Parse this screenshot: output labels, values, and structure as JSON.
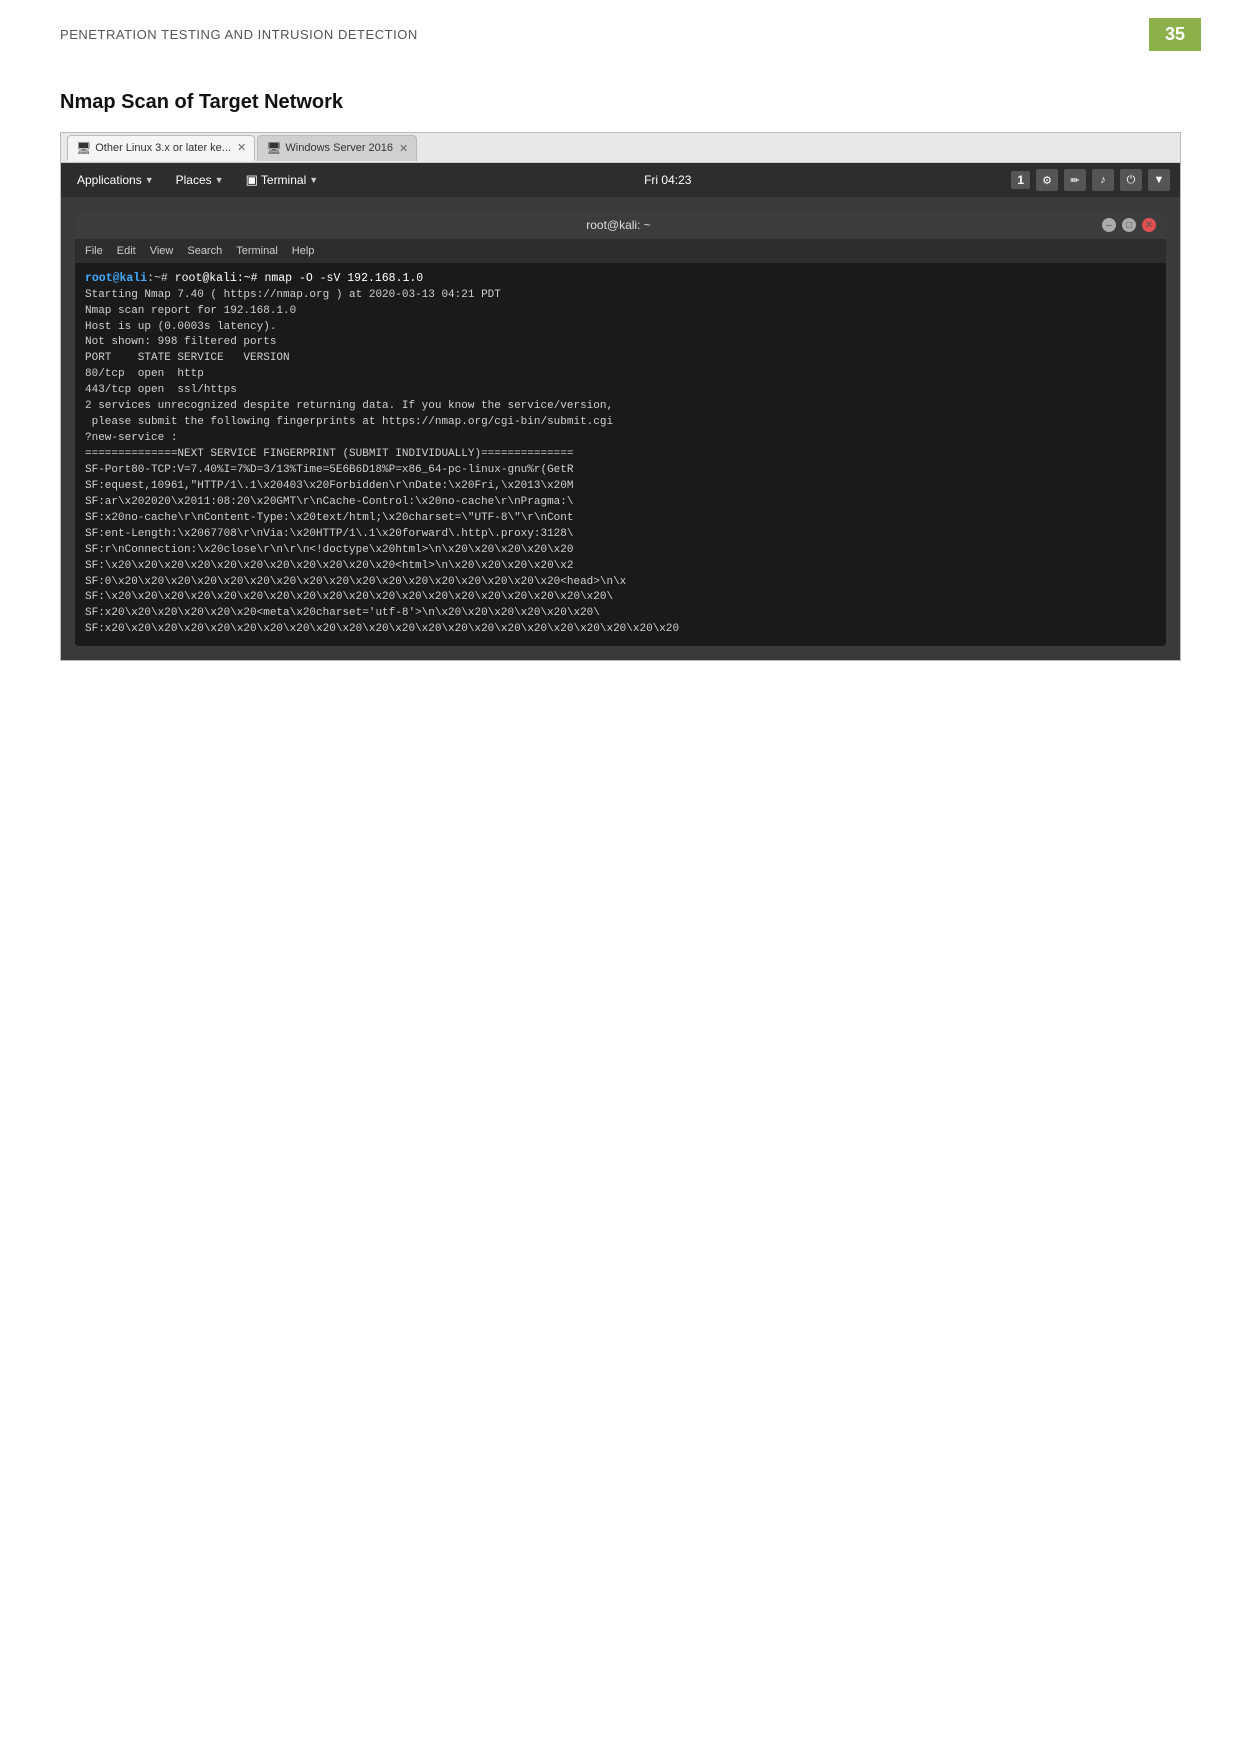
{
  "header": {
    "title": "PENETRATION TESTING AND INTRUSION DETECTION",
    "page_number": "35"
  },
  "section": {
    "heading": "Nmap Scan of Target Network"
  },
  "tabs": [
    {
      "label": "Other Linux 3.x or later ke...",
      "icon": "🖥",
      "active": true
    },
    {
      "label": "Windows Server 2016",
      "icon": "🖥",
      "active": false
    }
  ],
  "kali_toolbar": {
    "applications": "Applications",
    "places": "Places",
    "terminal": "Terminal",
    "clock": "Fri 04:23",
    "indicator": "1"
  },
  "terminal": {
    "title": "root@kali: ~",
    "menu_items": [
      "File",
      "Edit",
      "View",
      "Search",
      "Terminal",
      "Help"
    ],
    "command": "root@kali:~# nmap -O -sV 192.168.1.0",
    "output": [
      "",
      "Starting Nmap 7.40 ( https://nmap.org ) at 2020-03-13 04:21 PDT",
      "Nmap scan report for 192.168.1.0",
      "Host is up (0.0003s latency).",
      "Not shown: 998 filtered ports",
      "PORT    STATE SERVICE   VERSION",
      "80/tcp  open  http",
      "443/tcp open  ssl/https",
      "2 services unrecognized despite returning data. If you know the service/version,",
      " please submit the following fingerprints at https://nmap.org/cgi-bin/submit.cgi",
      "?new-service :",
      "==============NEXT SERVICE FINGERPRINT (SUBMIT INDIVIDUALLY)==============",
      "SF-Port80-TCP:V=7.40%I=7%D=3/13%Time=5E6B6D18%P=x86_64-pc-linux-gnu%r(GetR",
      "SF:equest,10961,\"HTTP/1\\.1\\x20403\\x20Forbidden\\r\\nDate:\\x20Fri,\\x2013\\x20M",
      "SF:ar\\x202020\\x2011:08:20\\x20GMT\\r\\nCache-Control:\\x20no-cache\\r\\nPragma:\\",
      "SF:x20no-cache\\r\\nContent-Type:\\x20text/html;\\x20charset=\\\"UTF-8\\\"\\r\\nCont",
      "SF:ent-Length:\\x2067708\\r\\nVia:\\x20HTTP/1\\.1\\x20forward\\.http\\.proxy:3128\\",
      "SF:r\\nConnection:\\x20close\\r\\n\\r\\n<!doctype\\x20html>\\n\\x20\\x20\\x20\\x20\\x20",
      "SF:\\x20\\x20\\x20\\x20\\x20\\x20\\x20\\x20\\x20\\x20\\x20<html>\\n\\x20\\x20\\x20\\x20\\x2",
      "SF:0\\x20\\x20\\x20\\x20\\x20\\x20\\x20\\x20\\x20\\x20\\x20\\x20\\x20\\x20\\x20\\x20\\x20<head>\\n\\x",
      "SF:\\x20\\x20\\x20\\x20\\x20\\x20\\x20\\x20\\x20\\x20\\x20\\x20\\x20\\x20\\x20\\x20\\x20\\x20\\x20\\",
      "SF:x20\\x20\\x20\\x20\\x20\\x20<meta\\x20charset='utf-8'>\\n\\x20\\x20\\x20\\x20\\x20\\x20\\",
      "SF:x20\\x20\\x20\\x20\\x20\\x20\\x20\\x20\\x20\\x20\\x20\\x20\\x20\\x20\\x20\\x20\\x20\\x20\\x20\\x20\\x20\\x20"
    ]
  }
}
